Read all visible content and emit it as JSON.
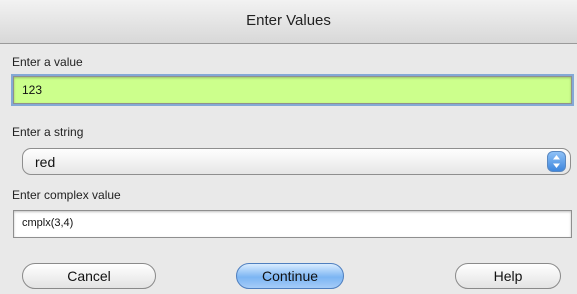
{
  "dialog": {
    "title": "Enter Values"
  },
  "fields": {
    "value_label": "Enter a value",
    "value_text": "123",
    "string_label": "Enter a string",
    "string_selected": "red",
    "complex_label": "Enter complex value",
    "complex_text": "cmplx(3,4)"
  },
  "buttons": {
    "cancel": "Cancel",
    "continue": "Continue",
    "help": "Help"
  },
  "colors": {
    "highlight_field": "#ccff8c",
    "default_button": "#7cb5f3"
  }
}
